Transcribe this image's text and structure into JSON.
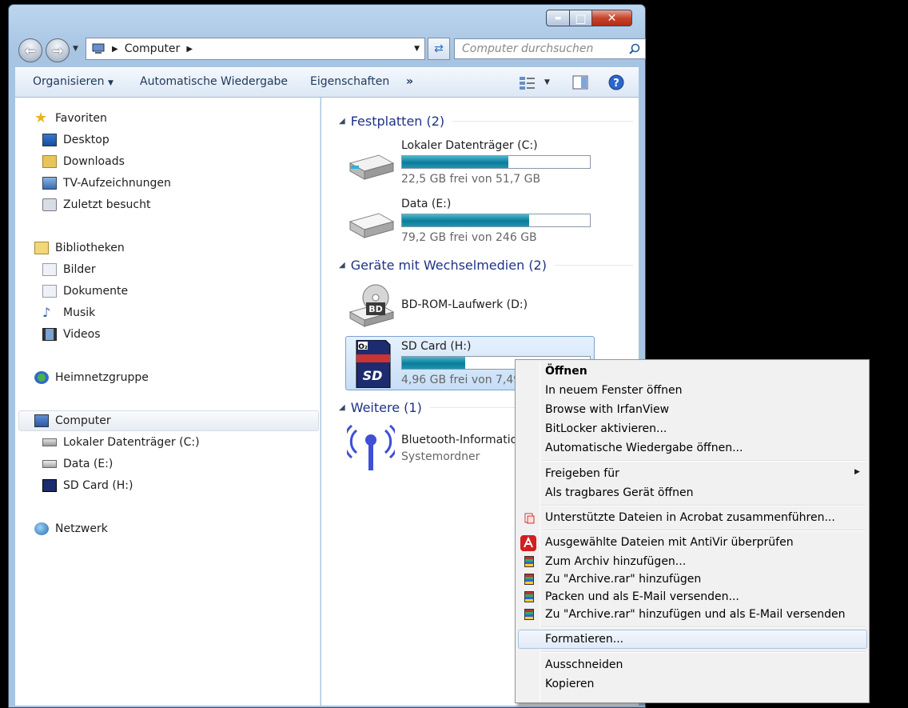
{
  "window": {
    "caption_buttons": {
      "minimize": "▬",
      "maximize": "□",
      "close": "✕"
    }
  },
  "address": {
    "crumb": "Computer"
  },
  "search": {
    "placeholder": "Computer durchsuchen"
  },
  "toolbar": {
    "organize": "Organisieren",
    "autoplay": "Automatische Wiedergabe",
    "properties": "Eigenschaften",
    "more": "»"
  },
  "sidebar": {
    "favorites": {
      "label": "Favoriten",
      "items": [
        "Desktop",
        "Downloads",
        "TV-Aufzeichnungen",
        "Zuletzt besucht"
      ]
    },
    "libraries": {
      "label": "Bibliotheken",
      "items": [
        "Bilder",
        "Dokumente",
        "Musik",
        "Videos"
      ]
    },
    "homegroup": "Heimnetzgruppe",
    "computer": {
      "label": "Computer",
      "items": [
        "Lokaler Datenträger (C:)",
        "Data (E:)",
        "SD Card (H:)"
      ]
    },
    "network": "Netzwerk"
  },
  "main": {
    "group_disks": "Festplatten (2)",
    "group_removable": "Geräte mit Wechselmedien (2)",
    "group_other": "Weitere (1)",
    "drives": [
      {
        "name": "Lokaler Datenträger (C:)",
        "free": "22,5 GB frei von 51,7 GB",
        "used_fraction": 0.565
      },
      {
        "name": "Data (E:)",
        "free": "79,2 GB frei von 246 GB",
        "used_fraction": 0.678
      }
    ],
    "bd": {
      "name": "BD-ROM-Laufwerk (D:)",
      "badge": "BD"
    },
    "sd": {
      "name": "SD Card (H:)",
      "free": "4,96 GB frei von 7,49 GB",
      "used_fraction": 0.338
    },
    "bt": {
      "name": "Bluetooth-Informationsaustausch",
      "sub": "Systemordner"
    }
  },
  "context_menu": {
    "open": "Öffnen",
    "open_new_window": "In neuem Fenster öffnen",
    "irfanview": "Browse with IrfanView",
    "bitlocker": "BitLocker aktivieren...",
    "autoplay_open": "Automatische Wiedergabe öffnen...",
    "share": "Freigeben für",
    "portable": "Als tragbares Gerät öffnen",
    "acrobat": "Unterstützte Dateien in Acrobat zusammenführen...",
    "antivir": "Ausgewählte Dateien mit AntiVir überprüfen",
    "rar_add": "Zum Archiv hinzufügen...",
    "rar_add_named": "Zu \"Archive.rar\" hinzufügen",
    "rar_email": "Packen und als E-Mail versenden...",
    "rar_named_email": "Zu \"Archive.rar\" hinzufügen und als E-Mail versenden",
    "format": "Formatieren...",
    "cut": "Ausschneiden",
    "copy": "Kopieren"
  }
}
